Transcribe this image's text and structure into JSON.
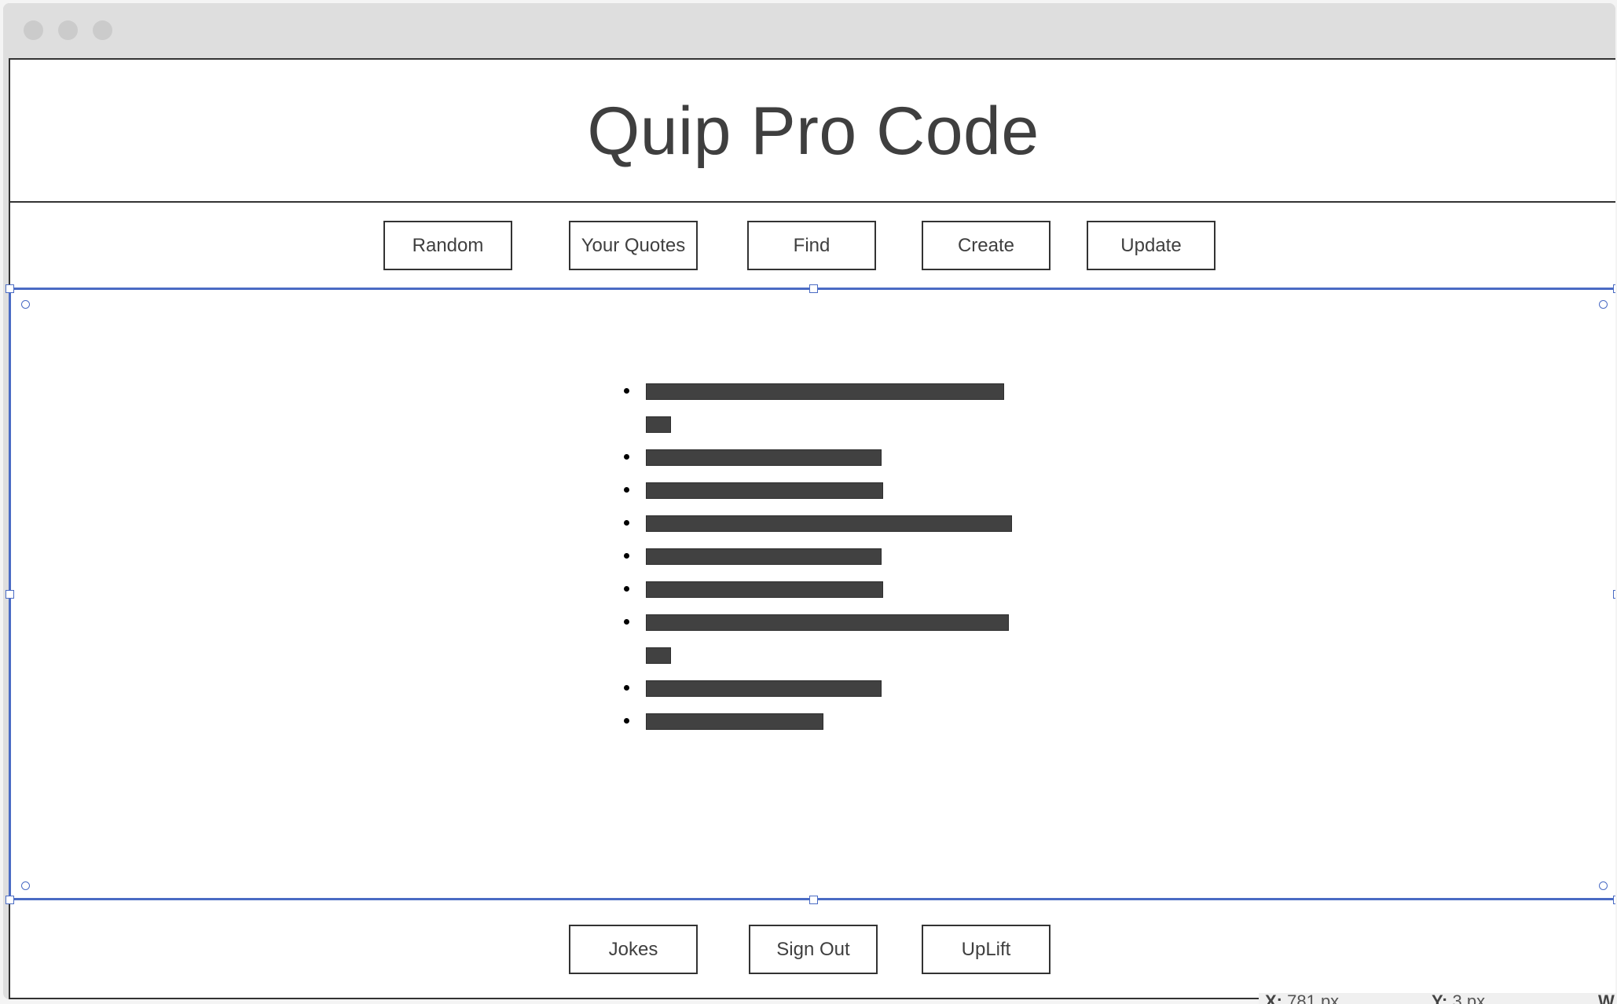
{
  "window": {
    "controls": [
      "close",
      "minimize",
      "maximize"
    ]
  },
  "header": {
    "title": "Quip Pro Code"
  },
  "nav": {
    "buttons": [
      {
        "label": "Random"
      },
      {
        "label": "Your Quotes"
      },
      {
        "label": "Find"
      },
      {
        "label": "Create"
      },
      {
        "label": "Update"
      }
    ]
  },
  "content": {
    "list_items": [
      {
        "bullet": true,
        "bar": "long-a"
      },
      {
        "bullet": false,
        "bar": "short"
      },
      {
        "bullet": true,
        "bar": "medium"
      },
      {
        "bullet": true,
        "bar": "medium"
      },
      {
        "bullet": true,
        "bar": "long-b"
      },
      {
        "bullet": true,
        "bar": "medium"
      },
      {
        "bullet": true,
        "bar": "medium"
      },
      {
        "bullet": true,
        "bar": "long-a"
      },
      {
        "bullet": false,
        "bar": "short"
      },
      {
        "bullet": true,
        "bar": "medium"
      },
      {
        "bullet": true,
        "bar": "small"
      }
    ]
  },
  "footer": {
    "buttons": [
      {
        "label": "Jokes"
      },
      {
        "label": "Sign Out"
      },
      {
        "label": "UpLift"
      }
    ]
  },
  "status": {
    "x_label": "X:",
    "x_value": "781 px",
    "y_label": "Y:",
    "y_value": "3 px",
    "w_label": "W"
  },
  "colors": {
    "selection": "#4a6bc4",
    "border": "#333333",
    "text": "#3f3f3f",
    "bar": "#414141"
  }
}
